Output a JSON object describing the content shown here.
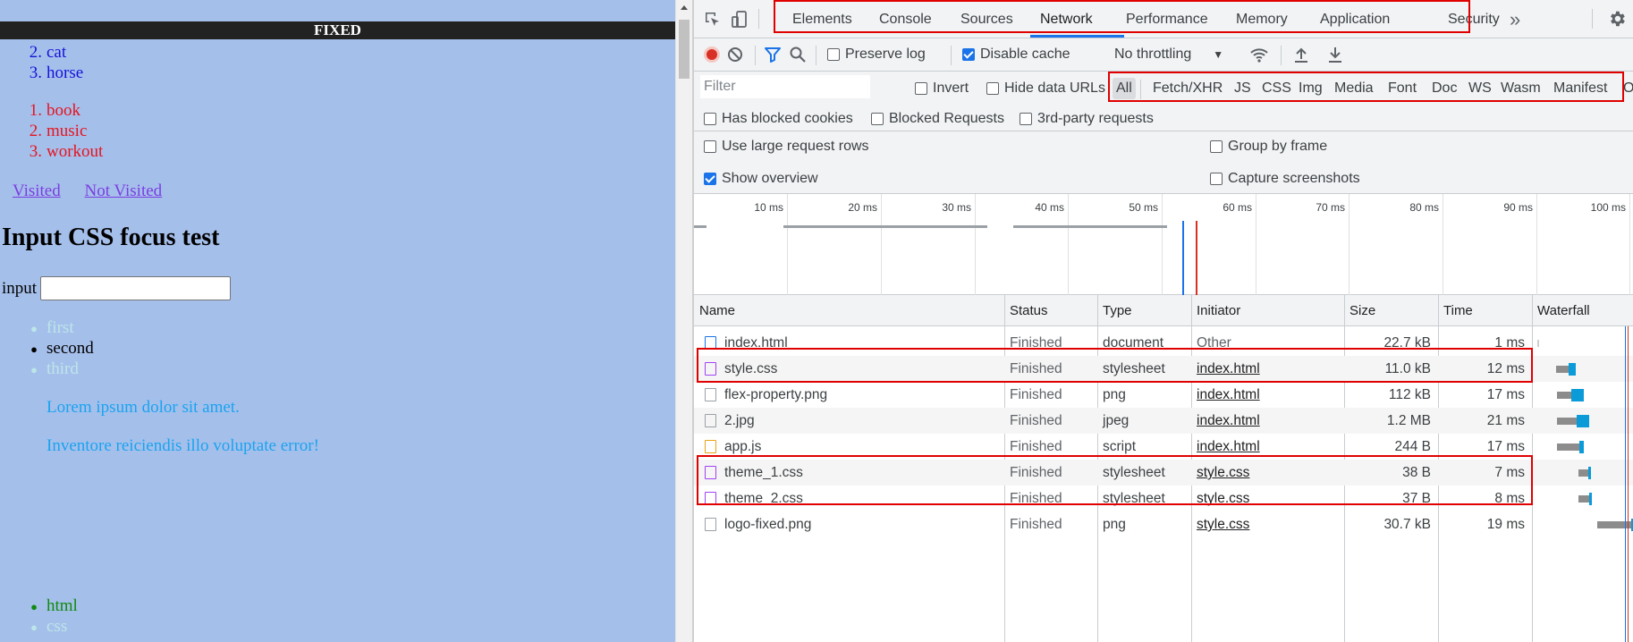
{
  "page": {
    "fixed_label": "FIXED",
    "ol_blue": [
      {
        "num": "2.",
        "text": "cat"
      },
      {
        "num": "3.",
        "text": "horse"
      }
    ],
    "ol_red": [
      {
        "num": "1.",
        "text": "book"
      },
      {
        "num": "2.",
        "text": "music"
      },
      {
        "num": "3.",
        "text": "workout"
      }
    ],
    "links": {
      "visited": "Visited",
      "not_visited": "Not Visited"
    },
    "heading": "Input CSS focus test",
    "input_label": "input",
    "input_value": "",
    "ul_focus": [
      {
        "text": "first",
        "color": "#bde6e8"
      },
      {
        "text": "second",
        "color": "#000000"
      },
      {
        "text": "third",
        "color": "#bde6e8"
      }
    ],
    "lorem1": "Lorem ipsum dolor sit amet.",
    "lorem2": "Inventore reiciendis illo voluptate error!",
    "ul_bottom": [
      {
        "text": "html",
        "color": "#0f8a0f"
      },
      {
        "text": "css",
        "color": "#bde6e8"
      }
    ]
  },
  "devtools": {
    "tabs": [
      "Elements",
      "Console",
      "Sources",
      "Network",
      "Performance",
      "Memory",
      "Application",
      "Security"
    ],
    "active_tab": "Network",
    "more_tabs": "»",
    "toolbar": {
      "preserve_log": "Preserve log",
      "preserve_log_checked": false,
      "disable_cache": "Disable cache",
      "disable_cache_checked": true,
      "throttling": "No throttling"
    },
    "filter": {
      "placeholder": "Filter",
      "invert": "Invert",
      "hide_data_urls": "Hide data URLs",
      "types": [
        "All",
        "Fetch/XHR",
        "JS",
        "CSS",
        "Img",
        "Media",
        "Font",
        "Doc",
        "WS",
        "Wasm",
        "Manifest",
        "O"
      ],
      "selected_type": "All"
    },
    "blocked": {
      "has_blocked_cookies": "Has blocked cookies",
      "blocked_requests": "Blocked Requests",
      "third_party": "3rd-party requests"
    },
    "options": {
      "large_rows": "Use large request rows",
      "group_by_frame": "Group by frame",
      "show_overview": "Show overview",
      "show_overview_checked": true,
      "capture_screenshots": "Capture screenshots"
    },
    "overview_ticks": [
      "10 ms",
      "20 ms",
      "30 ms",
      "40 ms",
      "50 ms",
      "60 ms",
      "70 ms",
      "80 ms",
      "90 ms",
      "100 ms"
    ],
    "columns": [
      "Name",
      "Status",
      "Type",
      "Initiator",
      "Size",
      "Time",
      "Waterfall"
    ],
    "rows": [
      {
        "name": "index.html",
        "status": "Finished",
        "type": "document",
        "initiator": "Other",
        "size": "22.7 kB",
        "time": "1 ms",
        "icon": "document-icon"
      },
      {
        "name": "style.css",
        "status": "Finished",
        "type": "stylesheet",
        "initiator": "index.html",
        "size": "11.0 kB",
        "time": "12 ms",
        "icon": "stylesheet-icon"
      },
      {
        "name": "flex-property.png",
        "status": "Finished",
        "type": "png",
        "initiator": "index.html",
        "size": "112 kB",
        "time": "17 ms",
        "icon": "image-icon"
      },
      {
        "name": "2.jpg",
        "status": "Finished",
        "type": "jpeg",
        "initiator": "index.html",
        "size": "1.2 MB",
        "time": "21 ms",
        "icon": "image-icon"
      },
      {
        "name": "app.js",
        "status": "Finished",
        "type": "script",
        "initiator": "index.html",
        "size": "244 B",
        "time": "17 ms",
        "icon": "script-icon"
      },
      {
        "name": "theme_1.css",
        "status": "Finished",
        "type": "stylesheet",
        "initiator": "style.css",
        "size": "38 B",
        "time": "7 ms",
        "icon": "stylesheet-icon"
      },
      {
        "name": "theme_2.css",
        "status": "Finished",
        "type": "stylesheet",
        "initiator": "style.css",
        "size": "37 B",
        "time": "8 ms",
        "icon": "stylesheet-icon"
      },
      {
        "name": "logo-fixed.png",
        "status": "Finished",
        "type": "png",
        "initiator": "style.css",
        "size": "30.7 kB",
        "time": "19 ms",
        "icon": "image-icon"
      }
    ],
    "colors": {
      "stylesheet": "#a142f4",
      "document": "#1a73e8",
      "script": "#e8a317",
      "image": "#9aa0a6",
      "highlight": "#e00000",
      "accent": "#1a73e8"
    }
  }
}
